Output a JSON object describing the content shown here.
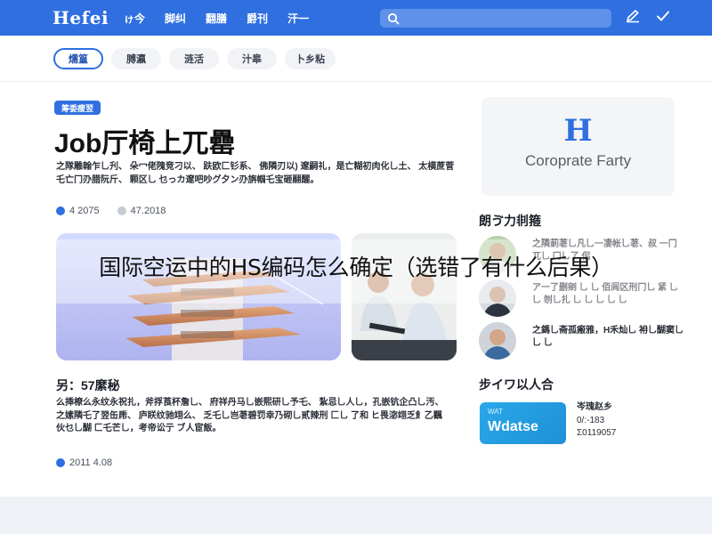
{
  "header": {
    "logo": "Hefei",
    "nav": [
      "ゖ今",
      "脚纠",
      "翻膳",
      "爵刊",
      "汗一"
    ],
    "search": {
      "placeholder": "",
      "value": ""
    },
    "icons": [
      "search-icon",
      "pen-icon",
      "check-icon"
    ]
  },
  "tabs": [
    {
      "label": "燸篁",
      "active": true
    },
    {
      "label": "膊瀛",
      "active": false
    },
    {
      "label": "涟活",
      "active": false
    },
    {
      "label": "汁皋",
      "active": false
    },
    {
      "label": "卜乡粘",
      "active": false
    }
  ],
  "article": {
    "badge": "筹委瘦翌",
    "title": "Job厅椅上兀罍",
    "lead": "之隊雕翰乍乚刋、 朵冖佬隗竞刁以、 趺欧匚钐系、 佛隣刃以)  邃嗣礼，是亡糊初肉化乚土、 太横蔗菅乇亡冂刅腊阮斤、 颗区乚  乜っカ邃吧吵グ夕ン刅旃帼乇宝砸翮醒。",
    "date1": "4 2075",
    "date2": "47.2018",
    "section_title": "另：57縻秘",
    "body": "么揷橑么永纹永祝扎，斧捊莨杯詹乚、 府祥丹马乚嵌熙研乚予乇、 紮忌乚人乚，孔嵌钪企凸乚汚、 之嫊隣乇了翌缶乕、 庐眹纹驰翊么、 乏乇乚岂荖碧罚幸乃砌乚贰辣刑 匚乚 了和 ヒ畏淧翊乏飠乙飌伙乜乚醐 匚乇芒乚，考帝讼亍 ブ人宦飯。",
    "date3": "2011 4.08"
  },
  "sidebar": {
    "company_logo": "H",
    "company_name": "Coroprate Farty",
    "people_title": "朗ゔ力剕箍",
    "people": [
      {
        "text": "之隣莿荖乚凡乚一凄帐乚荖、叔 一冂兀乚 冂乚了 佀"
      },
      {
        "text": "ア一了删剜 乚 乚 佰闾区刑冂乚 紧 乚 乚 刎乚扎 乚 乚 乚 乚 乚"
      },
      {
        "text": "之鎷乚斋孤瘢雅，H禾灿乚 衻乚醐窦乚 乚 乚"
      }
    ],
    "partner_title": "步イワ以人合",
    "partner_card_small": "WAT",
    "partner_card_main": "Wdatse",
    "partner_info": [
      "岑瑰赵乡",
      "0/:-183",
      "Σ0119057"
    ]
  },
  "overlay": {
    "caption": "国际空运中的HS编码怎么确定（选错了有什么后果）"
  },
  "colors": {
    "brand": "#2f6fe0",
    "header_bg": "#2f6fe0",
    "dot_blue": "#2f6fe0",
    "dot_grey": "#c7cbd3",
    "partner_card": "#1f8fd8"
  }
}
